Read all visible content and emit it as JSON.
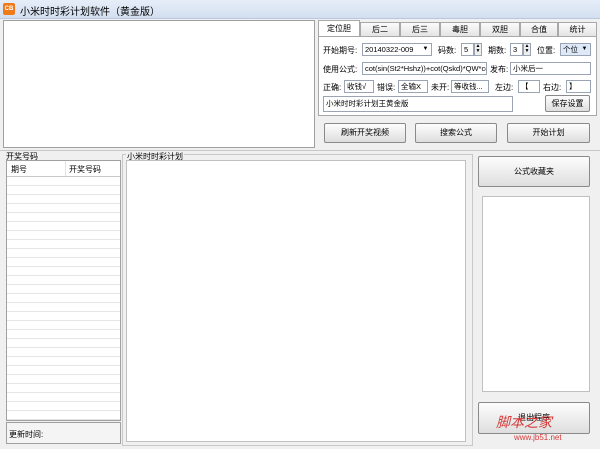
{
  "window": {
    "title": "小米时时彩计划软件（黄金版）",
    "icon": "app-icon"
  },
  "tabs": [
    {
      "label": "定位胆",
      "active": true
    },
    {
      "label": "后二",
      "active": false
    },
    {
      "label": "后三",
      "active": false
    },
    {
      "label": "毒胆",
      "active": false
    },
    {
      "label": "双胆",
      "active": false
    },
    {
      "label": "合值",
      "active": false
    },
    {
      "label": "统计",
      "active": false
    }
  ],
  "settings": {
    "start_period_label": "开始期号:",
    "start_period_value": "20140322-009",
    "code_count_label": "码数:",
    "code_count_value": "5",
    "period_count_label": "期数:",
    "period_count_value": "3",
    "position_label": "位置:",
    "position_value": "个位",
    "formula_label": "使用公式:",
    "formula_value": "cot(sin(St2*Hshz))+cot(Qskd)*QW*cc",
    "publish_label": "发布:",
    "publish_value": "小米后一",
    "correct_label": "正确:",
    "correct_value": "收钱√",
    "wrong_label": "错误:",
    "wrong_value": "全输X",
    "unopened_label": "未开:",
    "unopened_value": "等收钱...",
    "left_label": "左边:",
    "left_value": "【",
    "right_label": "右边:",
    "right_value": "】",
    "name_value": "小米时时彩计划王黄金版",
    "save_button": "保存设置"
  },
  "actions": {
    "refresh_button": "刷新开奖视频",
    "search_button": "搜索公式",
    "start_button": "开始计划"
  },
  "draw_list": {
    "title": "开奖号码",
    "col_period": "期号",
    "col_number": "开奖号码",
    "update_label": "更新时间:"
  },
  "plan": {
    "title": "小米时时彩计划"
  },
  "right_panel": {
    "favorites_button": "公式收藏夹",
    "exit_button": "退出程序"
  },
  "watermark": {
    "text": "脚本之家",
    "url": "www.jb51.net",
    "color": "#d63a3a"
  }
}
